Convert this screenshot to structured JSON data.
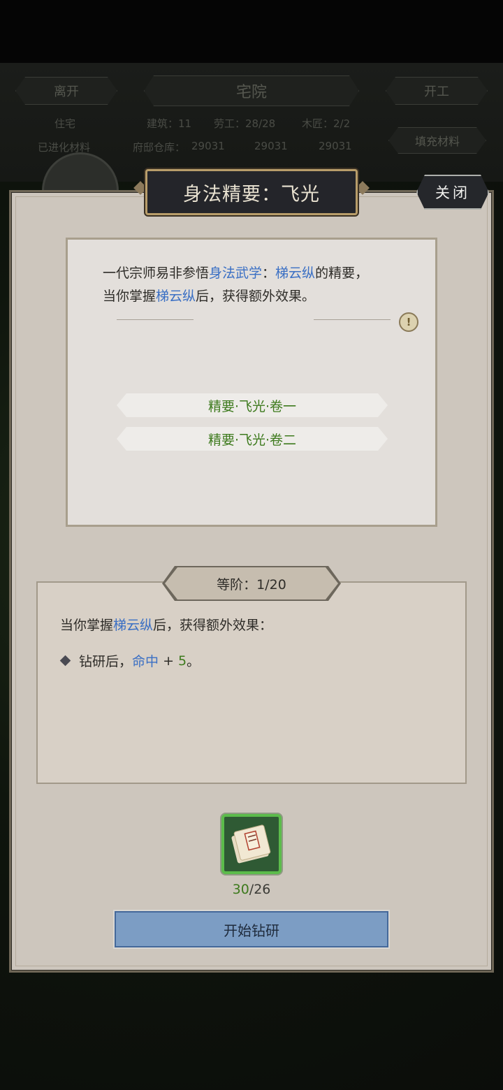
{
  "header": {
    "leave_label": "离开",
    "title": "宅院",
    "start_work_label": "开工",
    "stats_building": "建筑：11",
    "stats_workers": "劳工：28/28",
    "stats_wood": "木匠：2/2",
    "left_label_1": "住宅",
    "left_label_2": "已进化材料",
    "warehouse_label": "府邸仓库：",
    "res_1": "29031",
    "res_2": "29031",
    "res_3": "29031",
    "fill_label": "填充材料"
  },
  "dialog": {
    "title": "身法精要：飞光",
    "close_label": "关闭",
    "desc": {
      "line1_a": "一代宗师易非参悟",
      "line1_hl1": "身法武学",
      "line1_b": "：",
      "line1_hl2": "梯云纵",
      "line1_c": "的精要，",
      "line2_a": "当你掌握",
      "line2_hl": "梯云纵",
      "line2_b": "后，获得额外效果。",
      "info_icon": "exclamation-icon"
    },
    "volumes": [
      {
        "label": "精要·飞光·卷一"
      },
      {
        "label": "精要·飞光·卷二"
      }
    ],
    "rank": {
      "label": "等阶：1/20",
      "effect_head_a": "当你掌握",
      "effect_head_hl": "梯云纵",
      "effect_head_b": "后，获得额外效果：",
      "effect_a": "钻研后，",
      "effect_stat": "命中",
      "effect_plus": " + ",
      "effect_val": "5",
      "effect_end": "。"
    },
    "item": {
      "icon": "scroll-book-icon",
      "have": "30",
      "need": "/26"
    },
    "start_label": "开始钻研"
  }
}
